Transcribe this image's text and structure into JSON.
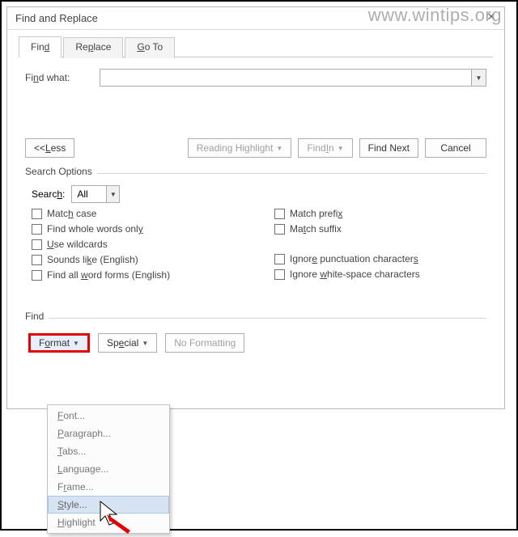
{
  "watermark": "www.wintips.org",
  "title": "Find and Replace",
  "tabs": {
    "find": "Find",
    "replace": "Replace",
    "goto": "Go To"
  },
  "find_what_label": "Find what:",
  "find_what_value": "",
  "buttons": {
    "less": "<< Less",
    "reading_highlight": "Reading Highlight",
    "find_in": "Find In",
    "find_next": "Find Next",
    "cancel": "Cancel",
    "format": "Format",
    "special": "Special",
    "no_formatting": "No Formatting"
  },
  "search_options_label": "Search Options",
  "search_label": "Search:",
  "search_value": "All",
  "checks": {
    "match_case": "Match case",
    "whole_words": "Find whole words only",
    "wildcards": "Use wildcards",
    "sounds_like": "Sounds like (English)",
    "word_forms": "Find all word forms (English)",
    "match_prefix": "Match prefix",
    "match_suffix": "Match suffix",
    "ignore_punct": "Ignore punctuation characters",
    "ignore_ws": "Ignore white-space characters"
  },
  "find_label": "Find",
  "format_menu": {
    "font": "Font...",
    "paragraph": "Paragraph...",
    "tabs": "Tabs...",
    "language": "Language...",
    "frame": "Frame...",
    "style": "Style...",
    "highlight": "Highlight"
  }
}
